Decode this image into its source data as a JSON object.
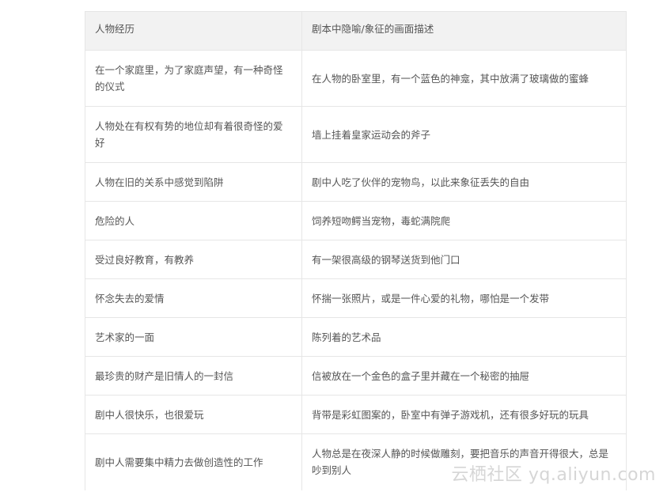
{
  "table": {
    "headers": [
      "人物经历",
      "剧本中隐喻/象征的画面描述"
    ],
    "rows": [
      [
        "在一个家庭里，为了家庭声望，有一种奇怪的仪式",
        "在人物的卧室里，有一个蓝色的神龛，其中放满了玻璃做的蜜蜂"
      ],
      [
        "人物处在有权有势的地位却有着很奇怪的爱好",
        "墙上挂着皇家运动会的斧子"
      ],
      [
        "人物在旧的关系中感觉到陷阱",
        "剧中人吃了伙伴的宠物鸟，以此来象征丢失的自由"
      ],
      [
        "危险的人",
        "饲养短吻鳄当宠物，毒蛇满院爬"
      ],
      [
        "受过良好教育，有教养",
        "有一架很高级的钢琴送货到他门口"
      ],
      [
        "怀念失去的爱情",
        "怀揣一张照片，或是一件心爱的礼物，哪怕是一个发带"
      ],
      [
        "艺术家的一面",
        "陈列着的艺术品"
      ],
      [
        "最珍贵的财产是旧情人的一封信",
        "信被放在一个金色的盒子里并藏在一个秘密的抽屉"
      ],
      [
        "剧中人很快乐，也很爱玩",
        "背带是彩虹图案的，卧室中有弹子游戏机，还有很多好玩的玩具"
      ],
      [
        "剧中人需要集中精力去做创造性的工作",
        "人物总是在夜深人静的时候做雕刻，要把音乐的声音开得很大，总是吵到别人"
      ]
    ]
  },
  "watermark": "云栖社区 yq.aliyun.com"
}
